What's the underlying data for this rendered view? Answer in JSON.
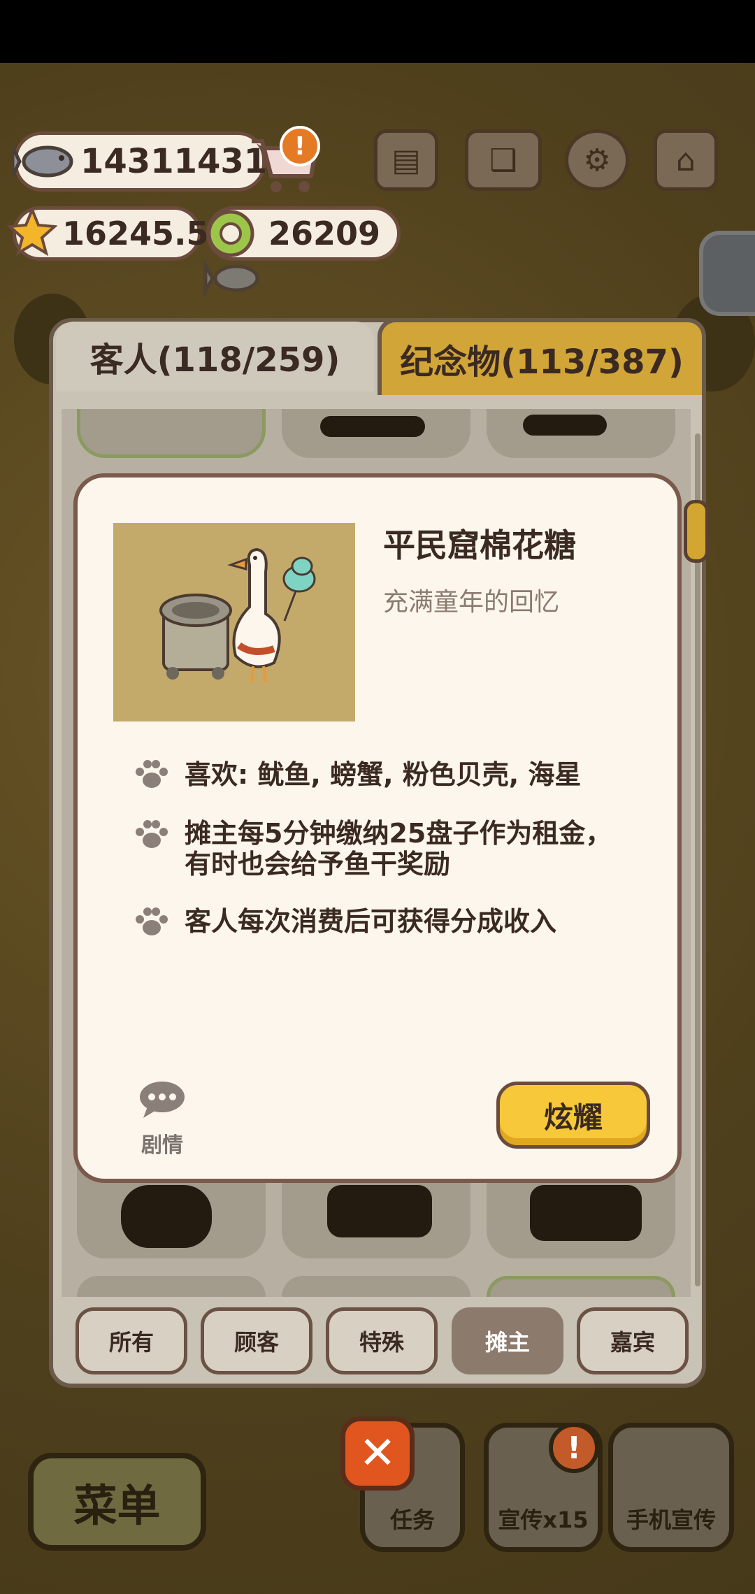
{
  "hud": {
    "fish": "14311431",
    "stars": "16245.5",
    "coins": "26209"
  },
  "tabs": {
    "guests": "客人(118/259)",
    "souvenirs": "纪念物(113/387)"
  },
  "detail": {
    "title": "平民窟棉花糖",
    "subtitle": "充满童年的回忆",
    "features": [
      "喜欢: 鱿鱼, 螃蟹, 粉色贝壳, 海星",
      "摊主每5分钟缴纳25盘子作为租金，",
      "有时也会给予鱼干奖励",
      "客人每次消费后可获得分成收入"
    ],
    "story_label": "剧情",
    "show_off_label": "炫耀"
  },
  "filters": [
    "所有",
    "顾客",
    "特殊",
    "摊主",
    "嘉宾"
  ],
  "active_filter": "摊主",
  "bottom": {
    "menu": "菜单",
    "tasks": "任务",
    "promo": "宣传x15",
    "phone_promo": "手机宣传"
  },
  "icons": {
    "fish": "fish-icon",
    "cart": "cart-icon",
    "star": "star-icon",
    "coin": "coin-icon",
    "news": "newspaper-icon",
    "book": "book-icon",
    "gear": "gear-icon",
    "shop": "shop-icon",
    "paw": "paw-icon",
    "chat": "chat-bubble-icon",
    "close": "close-icon",
    "alert": "exclamation-icon"
  },
  "colors": {
    "accent": "#f7c93a",
    "panel": "#fcf6ec",
    "text": "#3b2a22"
  }
}
